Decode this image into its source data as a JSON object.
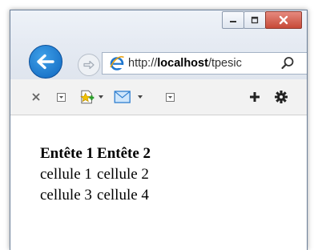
{
  "address_bar": {
    "url_prefix": "http://",
    "url_domain": "localhost",
    "url_path": "/tpesic"
  },
  "table": {
    "headers": [
      "Entête 1",
      "Entête 2"
    ],
    "rows": [
      [
        "cellule 1",
        "cellule 2"
      ],
      [
        "cellule 3",
        "cellule 4"
      ]
    ]
  }
}
